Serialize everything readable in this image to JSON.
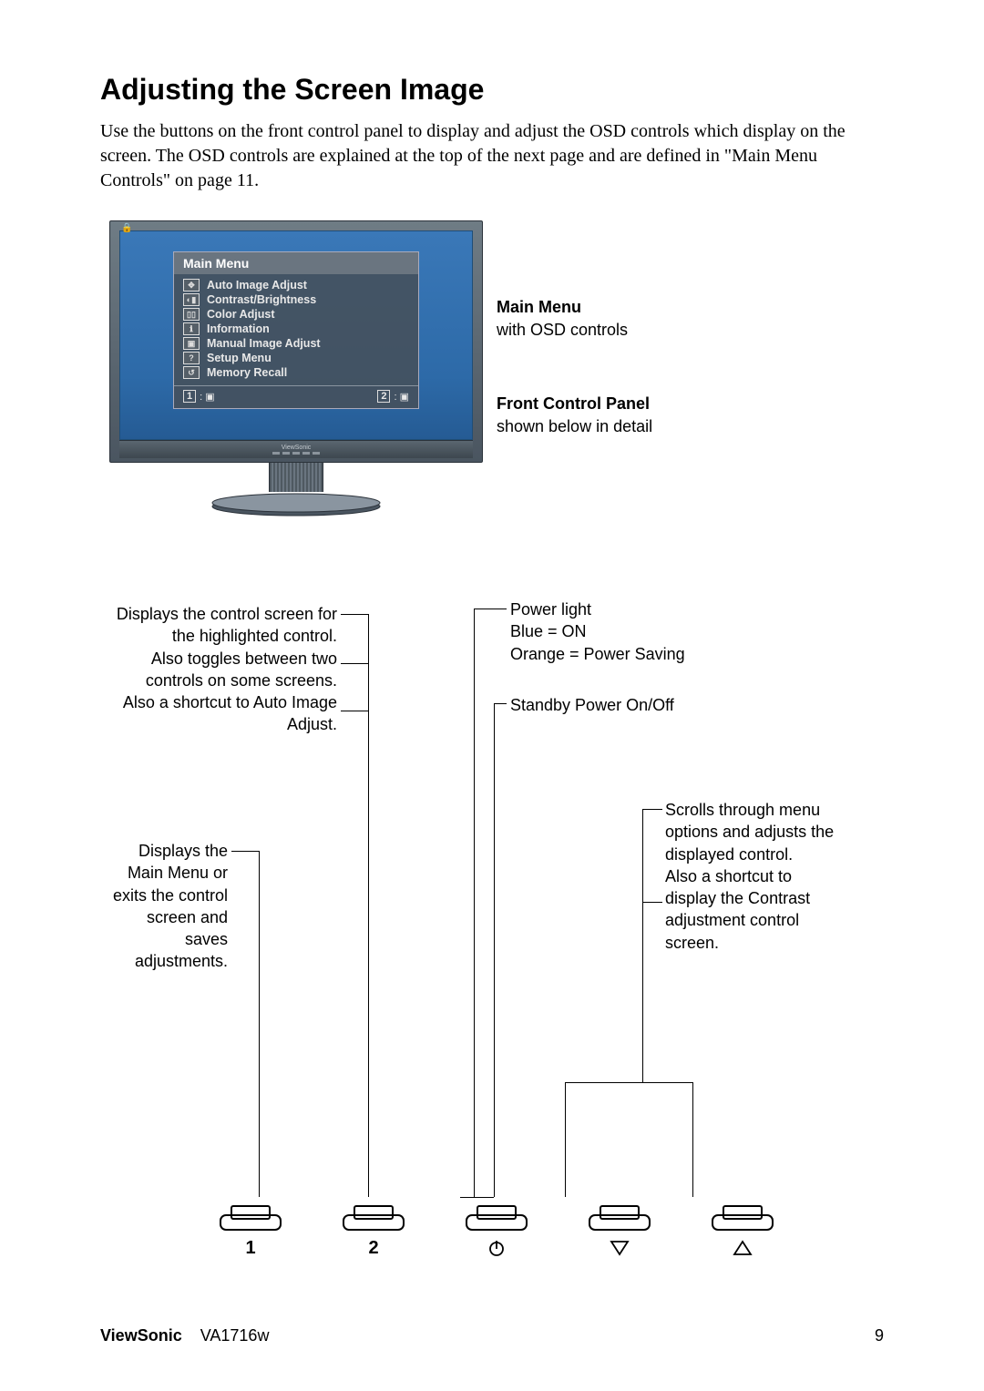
{
  "page": {
    "title": "Adjusting the Screen Image",
    "intro": "Use the buttons on the front control panel to display and adjust the OSD controls which display on the screen. The OSD controls are explained at the top of the next page and are defined in \"Main Menu Controls\" on page 11."
  },
  "osd": {
    "title": "Main Menu",
    "items": [
      "Auto Image Adjust",
      "Contrast/Brightness",
      "Color Adjust",
      "Information",
      "Manual Image Adjust",
      "Setup Menu",
      "Memory Recall"
    ],
    "foot1_num": "1",
    "foot1_sym": ": ▣",
    "foot2_num": "2",
    "foot2_sym": ": ▣",
    "brandlabel": "ViewSonic"
  },
  "side": {
    "main_title": "Main Menu",
    "main_text": "with OSD controls",
    "panel_title": "Front Control Panel",
    "panel_text": "shown below in detail"
  },
  "callouts": {
    "btn2_a": "Displays the control screen for the highlighted control.",
    "btn2_b": "Also toggles between two controls on some screens.",
    "btn2_c": "Also a shortcut to Auto Image Adjust.",
    "btn1": "Displays the Main Menu or exits the control screen and saves adjustments.",
    "power_a": "Power light",
    "power_b": "Blue = ON",
    "power_c": "Orange = Power Saving",
    "standby": "Standby Power On/Off",
    "arrows_a": "Scrolls through menu options and adjusts the displayed control.",
    "arrows_b": "Also a shortcut to display the Contrast adjustment control screen."
  },
  "buttons": {
    "b1": "1",
    "b2": "2",
    "b3_icon": "power",
    "b4_icon": "down",
    "b5_icon": "up"
  },
  "footer": {
    "brand": "ViewSonic",
    "model": "VA1716w",
    "page": "9"
  }
}
